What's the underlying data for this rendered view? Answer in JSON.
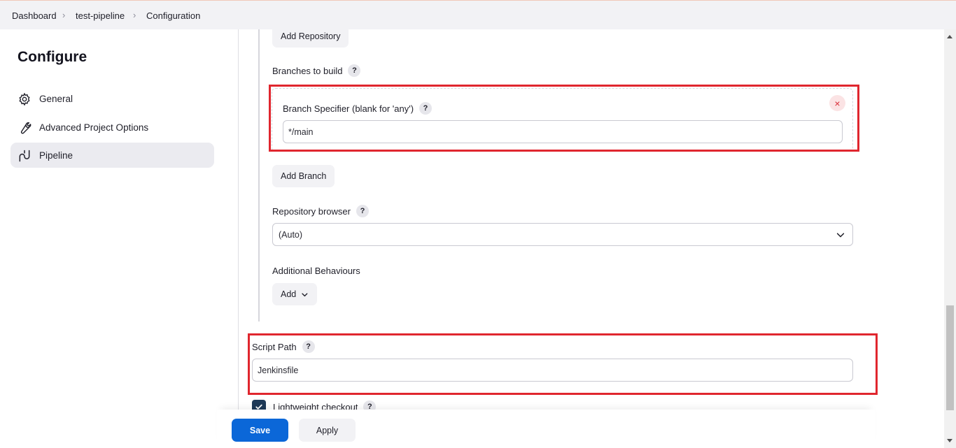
{
  "breadcrumb": {
    "items": [
      "Dashboard",
      "test-pipeline",
      "Configuration"
    ]
  },
  "sidebar": {
    "title": "Configure",
    "items": [
      {
        "label": "General",
        "icon": "gear-icon"
      },
      {
        "label": "Advanced Project Options",
        "icon": "wrench-icon"
      },
      {
        "label": "Pipeline",
        "icon": "pipeline-icon"
      }
    ],
    "active": "Pipeline"
  },
  "scm": {
    "add_repository_label": "Add Repository",
    "branches_label": "Branches to build",
    "branch_specifier_label": "Branch Specifier (blank for 'any')",
    "branch_specifier_value": "*/main",
    "add_branch_label": "Add Branch",
    "repo_browser_label": "Repository browser",
    "repo_browser_value": "(Auto)",
    "additional_behaviours_label": "Additional Behaviours",
    "add_label": "Add"
  },
  "script": {
    "path_label": "Script Path",
    "path_value": "Jenkinsfile",
    "lightweight_label": "Lightweight checkout",
    "lightweight_checked": true
  },
  "help_glyph": "?",
  "close_glyph": "×",
  "actions": {
    "save_label": "Save",
    "apply_label": "Apply"
  },
  "colors": {
    "accent": "#0b67d8",
    "highlight": "#e0262e"
  }
}
